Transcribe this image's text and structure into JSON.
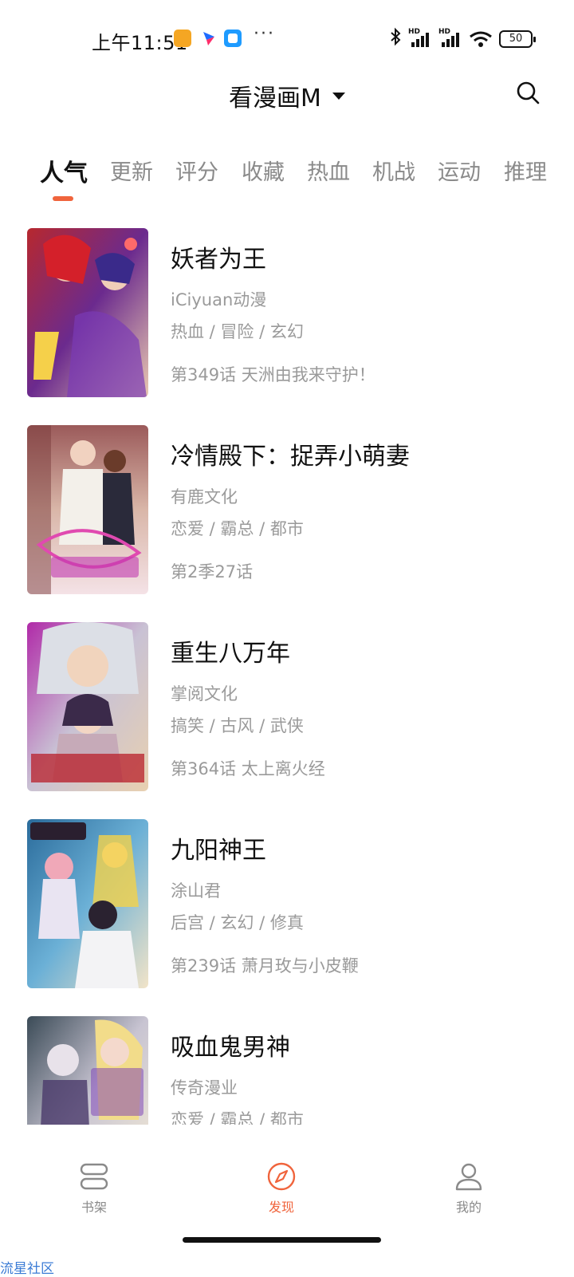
{
  "status_bar": {
    "time": "上午11:51",
    "more": "···",
    "battery": "50",
    "hd": "HD"
  },
  "header": {
    "title": "看漫画M"
  },
  "tabs": [
    {
      "label": "人气",
      "active": true
    },
    {
      "label": "更新"
    },
    {
      "label": "评分"
    },
    {
      "label": "收藏"
    },
    {
      "label": "热血"
    },
    {
      "label": "机战"
    },
    {
      "label": "运动"
    },
    {
      "label": "推理"
    }
  ],
  "comics": [
    {
      "title": "妖者为王",
      "author": "iCiyuan动漫",
      "tags": "热血 / 冒险 / 玄幻",
      "chapter": "第349话 天洲由我来守护！"
    },
    {
      "title": "冷情殿下：捉弄小萌妻",
      "author": "有鹿文化",
      "tags": "恋爱 / 霸总 / 都市",
      "chapter": "第2季27话"
    },
    {
      "title": "重生八万年",
      "author": "掌阅文化",
      "tags": "搞笑 / 古风 / 武侠",
      "chapter": "第364话 太上离火经"
    },
    {
      "title": "九阳神王",
      "author": "涂山君",
      "tags": "后宫 / 玄幻 / 修真",
      "chapter": "第239话 萧月玫与小皮鞭"
    },
    {
      "title": "吸血鬼男神",
      "author": "传奇漫业",
      "tags": "恋爱 / 霸总 / 都市",
      "chapter": ""
    }
  ],
  "bottom_nav": [
    {
      "label": "书架",
      "icon": "bookshelf-icon"
    },
    {
      "label": "发现",
      "icon": "compass-icon",
      "active": true
    },
    {
      "label": "我的",
      "icon": "user-icon"
    }
  ],
  "watermark": "流星社区",
  "colors": {
    "accent": "#f0643c",
    "muted_text": "#9a9a9a"
  }
}
